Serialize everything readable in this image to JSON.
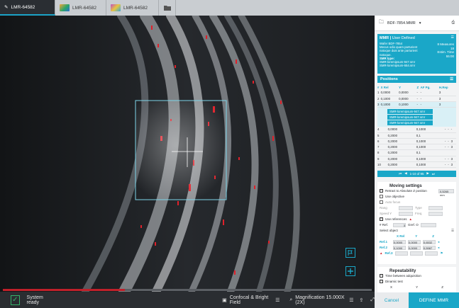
{
  "tabs": [
    {
      "label": "LMR-64582",
      "active": true
    },
    {
      "label": "LMR-64582",
      "active": false
    },
    {
      "label": "LMR-64582",
      "active": false
    }
  ],
  "status": {
    "text": "System ready",
    "mode": "Confocal & Bright Field",
    "magnification": "Magnification 15.000X (2X)",
    "progress_fraction": 0.33
  },
  "panel": {
    "file_name": "BDF-7854.MMR",
    "mmr": {
      "label": "MMR",
      "user_defined": "User Defined",
      "wafer": "Wafer BDF-7854",
      "description": "Mecus odio quam parturient natoque duis ante parturient natoque.",
      "smr_type": "SMR type:",
      "smr1": "SMR-loremipsum-947.smr",
      "smr2": "SMR-loremipsum-654.smr",
      "measures": "8 Measures",
      "measures_count": "18",
      "estim_label": "Estim. Time",
      "estim_value": "55:00"
    },
    "positions": {
      "title": "Positions",
      "headers": [
        "#",
        "X Rel",
        "Y",
        "Z",
        "AF Pg.",
        "H.Rep"
      ],
      "rows": [
        {
          "n": "1",
          "x": "0,0000",
          "y": "0,0000",
          "z": "-",
          "af": "-",
          "hrep": "3"
        },
        {
          "n": "2",
          "x": "0,1000",
          "y": "0,0000",
          "z": "-",
          "af": "-",
          "hrep": "3"
        },
        {
          "n": "3",
          "x": "0,1000",
          "y": "0,1000",
          "z": "-",
          "af": "-",
          "hrep": "3"
        }
      ],
      "chips": [
        "SMR-loremipsum-947.smr",
        "SMR-loremipsum-947.smr",
        "SMR-loremipsum-947.smr"
      ],
      "rows2": [
        {
          "n": "4",
          "x": "0,0000",
          "y": "0,1000",
          "z": "-",
          "af": "-",
          "hrep": "-"
        },
        {
          "n": "5",
          "x": "0,2000",
          "y": "0,1",
          "z": "",
          "af": "",
          "hrep": ""
        },
        {
          "n": "6",
          "x": "0,2000",
          "y": "0,1000",
          "z": "-",
          "af": "-",
          "hrep": "3"
        },
        {
          "n": "7",
          "x": "0,2000",
          "y": "0,1000",
          "z": "-",
          "af": "-",
          "hrep": "3"
        },
        {
          "n": "8",
          "x": "0,2000",
          "y": "0,1",
          "z": "",
          "af": "",
          "hrep": ""
        },
        {
          "n": "9",
          "x": "0,2000",
          "y": "0,1000",
          "z": "-",
          "af": "-",
          "hrep": "3"
        },
        {
          "n": "10",
          "x": "0,2000",
          "y": "0,1000",
          "z": "-",
          "af": "-",
          "hrep": "3"
        }
      ],
      "pager": "1-10 of 95"
    },
    "moving": {
      "title": "Moving settings",
      "retract": "Retract to Absolute Z position",
      "retract_value": "0,5265 mm",
      "use_objective": "Use objective",
      "auto_focus": "Auto focus",
      "rang": "Rang",
      "type": "Type",
      "speed": "Speed Y",
      "freq": "Freq.",
      "use_refs": "Use references",
      "nref_label": "# Ref.",
      "nref_value": "3",
      "gref_label": "Gref. O",
      "select_object": "Select object",
      "ref_headers": [
        "X Rel",
        "Y",
        "Z"
      ],
      "refs": [
        {
          "label": "Ref.1",
          "x": "0,0000",
          "y": "0,0000",
          "z": "0,6532"
        },
        {
          "label": "Ref.2",
          "x": "0,1000",
          "y": "0,0000",
          "z": "0,5987"
        },
        {
          "label": "Ref.3",
          "x": "",
          "y": "",
          "z": ""
        }
      ]
    },
    "repeatability": {
      "title": "Repeatability",
      "time_between": "Time between adquisition",
      "dinamic": "Dinamic test",
      "x": "X",
      "y": "Y",
      "z": "Z"
    },
    "cancel": "Cancel",
    "define": "DEFINE MMR"
  }
}
